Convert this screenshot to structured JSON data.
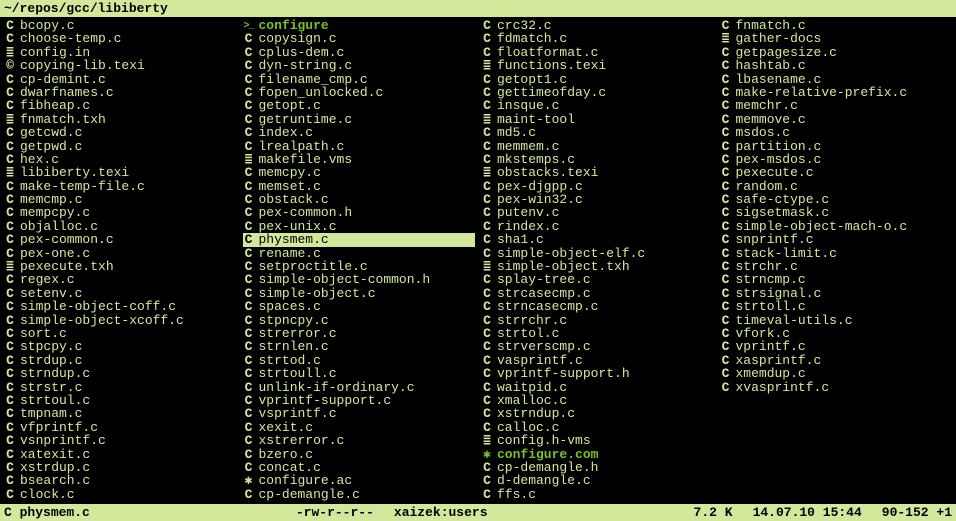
{
  "titlebar": "~/repos/gcc/libiberty",
  "status": {
    "icon": "C",
    "name": "physmem.c",
    "perms": "-rw-r--r--",
    "owner": "xaizek:users",
    "size": "7.2 K",
    "date": "14.07.10 15:44",
    "pos": "90-152 +1"
  },
  "files": [
    {
      "n": "bcopy.c",
      "i": "c"
    },
    {
      "n": "choose-temp.c",
      "i": "c"
    },
    {
      "n": "config.in",
      "i": "doc"
    },
    {
      "n": "copying-lib.texi",
      "i": "copy"
    },
    {
      "n": "cp-demint.c",
      "i": "c"
    },
    {
      "n": "dwarfnames.c",
      "i": "c"
    },
    {
      "n": "fibheap.c",
      "i": "c"
    },
    {
      "n": "fnmatch.txh",
      "i": "doc"
    },
    {
      "n": "getcwd.c",
      "i": "c"
    },
    {
      "n": "getpwd.c",
      "i": "c"
    },
    {
      "n": "hex.c",
      "i": "c"
    },
    {
      "n": "libiberty.texi",
      "i": "doc"
    },
    {
      "n": "make-temp-file.c",
      "i": "c"
    },
    {
      "n": "memcmp.c",
      "i": "c"
    },
    {
      "n": "mempcpy.c",
      "i": "c"
    },
    {
      "n": "objalloc.c",
      "i": "c"
    },
    {
      "n": "pex-common.c",
      "i": "c"
    },
    {
      "n": "pex-one.c",
      "i": "c"
    },
    {
      "n": "pexecute.txh",
      "i": "doc"
    },
    {
      "n": "regex.c",
      "i": "c"
    },
    {
      "n": "setenv.c",
      "i": "c"
    },
    {
      "n": "simple-object-coff.c",
      "i": "c"
    },
    {
      "n": "simple-object-xcoff.c",
      "i": "c"
    },
    {
      "n": "sort.c",
      "i": "c"
    },
    {
      "n": "stpcpy.c",
      "i": "c"
    },
    {
      "n": "strdup.c",
      "i": "c"
    },
    {
      "n": "strndup.c",
      "i": "c"
    },
    {
      "n": "strstr.c",
      "i": "c"
    },
    {
      "n": "strtoul.c",
      "i": "c"
    },
    {
      "n": "tmpnam.c",
      "i": "c"
    },
    {
      "n": "vfprintf.c",
      "i": "c"
    },
    {
      "n": "vsnprintf.c",
      "i": "c"
    },
    {
      "n": "xatexit.c",
      "i": "c"
    },
    {
      "n": "xstrdup.c",
      "i": "c"
    },
    {
      "n": "bsearch.c",
      "i": "c"
    },
    {
      "n": "clock.c",
      "i": "c"
    },
    {
      "n": "configure",
      "i": "exe",
      "exec": true
    },
    {
      "n": "copysign.c",
      "i": "c"
    },
    {
      "n": "cplus-dem.c",
      "i": "c"
    },
    {
      "n": "dyn-string.c",
      "i": "c"
    },
    {
      "n": "filename_cmp.c",
      "i": "c"
    },
    {
      "n": "fopen_unlocked.c",
      "i": "c"
    },
    {
      "n": "getopt.c",
      "i": "c"
    },
    {
      "n": "getruntime.c",
      "i": "c"
    },
    {
      "n": "index.c",
      "i": "c"
    },
    {
      "n": "lrealpath.c",
      "i": "c"
    },
    {
      "n": "makefile.vms",
      "i": "doc"
    },
    {
      "n": "memcpy.c",
      "i": "c"
    },
    {
      "n": "memset.c",
      "i": "c"
    },
    {
      "n": "obstack.c",
      "i": "c"
    },
    {
      "n": "pex-common.h",
      "i": "h"
    },
    {
      "n": "pex-unix.c",
      "i": "c"
    },
    {
      "n": "physmem.c",
      "i": "c",
      "sel": true
    },
    {
      "n": "rename.c",
      "i": "c"
    },
    {
      "n": "setproctitle.c",
      "i": "c"
    },
    {
      "n": "simple-object-common.h",
      "i": "h"
    },
    {
      "n": "simple-object.c",
      "i": "c"
    },
    {
      "n": "spaces.c",
      "i": "c"
    },
    {
      "n": "stpncpy.c",
      "i": "c"
    },
    {
      "n": "strerror.c",
      "i": "c"
    },
    {
      "n": "strnlen.c",
      "i": "c"
    },
    {
      "n": "strtod.c",
      "i": "c"
    },
    {
      "n": "strtoull.c",
      "i": "c"
    },
    {
      "n": "unlink-if-ordinary.c",
      "i": "c"
    },
    {
      "n": "vprintf-support.c",
      "i": "c"
    },
    {
      "n": "vsprintf.c",
      "i": "c"
    },
    {
      "n": "xexit.c",
      "i": "c"
    },
    {
      "n": "xstrerror.c",
      "i": "c"
    },
    {
      "n": "bzero.c",
      "i": "c"
    },
    {
      "n": "concat.c",
      "i": "c"
    },
    {
      "n": "configure.ac",
      "i": "gear"
    },
    {
      "n": "cp-demangle.c",
      "i": "c"
    },
    {
      "n": "crc32.c",
      "i": "c"
    },
    {
      "n": "fdmatch.c",
      "i": "c"
    },
    {
      "n": "floatformat.c",
      "i": "c"
    },
    {
      "n": "functions.texi",
      "i": "doc"
    },
    {
      "n": "getopt1.c",
      "i": "c"
    },
    {
      "n": "gettimeofday.c",
      "i": "c"
    },
    {
      "n": "insque.c",
      "i": "c"
    },
    {
      "n": "maint-tool",
      "i": "doc"
    },
    {
      "n": "md5.c",
      "i": "c"
    },
    {
      "n": "memmem.c",
      "i": "c"
    },
    {
      "n": "mkstemps.c",
      "i": "c"
    },
    {
      "n": "obstacks.texi",
      "i": "doc"
    },
    {
      "n": "pex-djgpp.c",
      "i": "c"
    },
    {
      "n": "pex-win32.c",
      "i": "c"
    },
    {
      "n": "putenv.c",
      "i": "c"
    },
    {
      "n": "rindex.c",
      "i": "c"
    },
    {
      "n": "sha1.c",
      "i": "c"
    },
    {
      "n": "simple-object-elf.c",
      "i": "c"
    },
    {
      "n": "simple-object.txh",
      "i": "doc"
    },
    {
      "n": "splay-tree.c",
      "i": "c"
    },
    {
      "n": "strcasecmp.c",
      "i": "c"
    },
    {
      "n": "strncasecmp.c",
      "i": "c"
    },
    {
      "n": "strrchr.c",
      "i": "c"
    },
    {
      "n": "strtol.c",
      "i": "c"
    },
    {
      "n": "strverscmp.c",
      "i": "c"
    },
    {
      "n": "vasprintf.c",
      "i": "c"
    },
    {
      "n": "vprintf-support.h",
      "i": "h"
    },
    {
      "n": "waitpid.c",
      "i": "c"
    },
    {
      "n": "xmalloc.c",
      "i": "c"
    },
    {
      "n": "xstrndup.c",
      "i": "c"
    },
    {
      "n": "calloc.c",
      "i": "c"
    },
    {
      "n": "config.h-vms",
      "i": "doc"
    },
    {
      "n": "configure.com",
      "i": "gear",
      "exec": true
    },
    {
      "n": "cp-demangle.h",
      "i": "h"
    },
    {
      "n": "d-demangle.c",
      "i": "c"
    },
    {
      "n": "ffs.c",
      "i": "c"
    },
    {
      "n": "fnmatch.c",
      "i": "c"
    },
    {
      "n": "gather-docs",
      "i": "doc"
    },
    {
      "n": "getpagesize.c",
      "i": "c"
    },
    {
      "n": "hashtab.c",
      "i": "c"
    },
    {
      "n": "lbasename.c",
      "i": "c"
    },
    {
      "n": "make-relative-prefix.c",
      "i": "c"
    },
    {
      "n": "memchr.c",
      "i": "c"
    },
    {
      "n": "memmove.c",
      "i": "c"
    },
    {
      "n": "msdos.c",
      "i": "c"
    },
    {
      "n": "partition.c",
      "i": "c"
    },
    {
      "n": "pex-msdos.c",
      "i": "c"
    },
    {
      "n": "pexecute.c",
      "i": "c"
    },
    {
      "n": "random.c",
      "i": "c"
    },
    {
      "n": "safe-ctype.c",
      "i": "c"
    },
    {
      "n": "sigsetmask.c",
      "i": "c"
    },
    {
      "n": "simple-object-mach-o.c",
      "i": "c"
    },
    {
      "n": "snprintf.c",
      "i": "c"
    },
    {
      "n": "stack-limit.c",
      "i": "c"
    },
    {
      "n": "strchr.c",
      "i": "c"
    },
    {
      "n": "strncmp.c",
      "i": "c"
    },
    {
      "n": "strsignal.c",
      "i": "c"
    },
    {
      "n": "strtoll.c",
      "i": "c"
    },
    {
      "n": "timeval-utils.c",
      "i": "c"
    },
    {
      "n": "vfork.c",
      "i": "c"
    },
    {
      "n": "vprintf.c",
      "i": "c"
    },
    {
      "n": "xasprintf.c",
      "i": "c"
    },
    {
      "n": "xmemdup.c",
      "i": "c"
    },
    {
      "n": "xvasprintf.c",
      "i": "c"
    }
  ]
}
